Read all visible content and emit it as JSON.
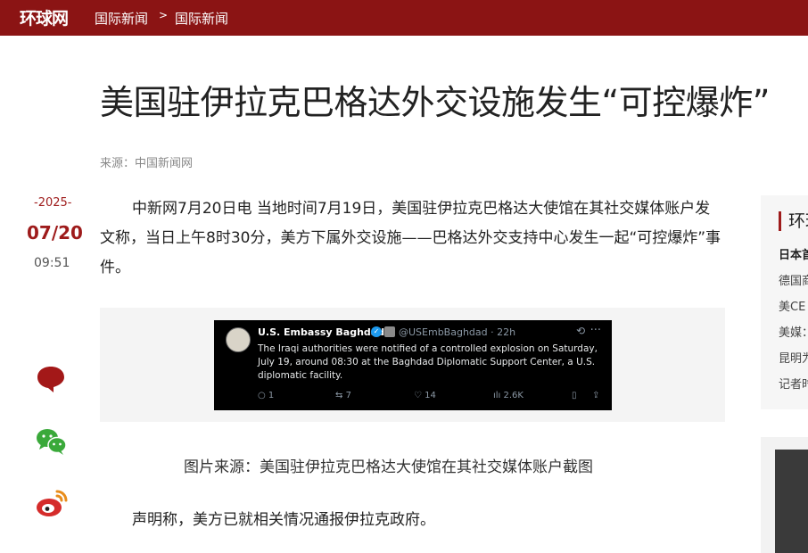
{
  "header": {
    "logo": "环球网",
    "breadcrumb": [
      "国际新闻",
      "国际新闻"
    ],
    "breadcrumb_separator": ">"
  },
  "article": {
    "title": "美国驻伊拉克巴格达外交设施发生“可控爆炸”",
    "source": "来源：中国新闻网",
    "date": {
      "year": "-2025-",
      "day": "07/20",
      "time": "09:51"
    },
    "paragraph1": "中新网7月20日电 当地时间7月19日，美国驻伊拉克巴格达大使馆在其社交媒体账户发文称，当日上午8时30分，美方下属外交设施——巴格达外交支持中心发生一起“可控爆炸”事件。",
    "image_caption": "图片来源：美国驻伊拉克巴格达大使馆在其社交媒体账户截图",
    "paragraph2": "声明称，美方已就相关情况通报伊拉克政府。"
  },
  "tweet": {
    "name": "U.S. Embassy Baghdad",
    "handle": "@USEmbBaghdad · 22h",
    "text": "The Iraqi authorities were notified of a controlled explosion on Saturday, July 19, around 08:30 at the Baghdad Diplomatic Support Center, a U.S. diplomatic facility.",
    "replies": "1",
    "retweets": "7",
    "likes": "14",
    "views": "2.6K"
  },
  "share": {
    "icons": [
      "comment-icon",
      "wechat-icon",
      "weibo-icon"
    ]
  },
  "sidebar": {
    "title": "环球",
    "items": [
      "日本首",
      "德国商",
      "美CE",
      "美媒：",
      "昆明为",
      "记者时"
    ]
  },
  "colors": {
    "brand": "#8b1414",
    "accent": "#9e1b1b"
  }
}
